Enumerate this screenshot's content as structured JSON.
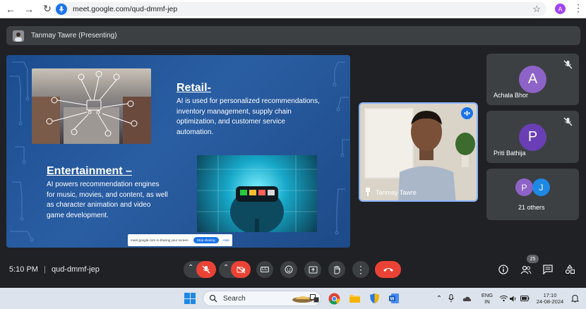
{
  "browser": {
    "url": "meet.google.com/qud-dmmf-jep",
    "profile_initial": "A"
  },
  "meet": {
    "presenting_label": "Tanmay Tawre (Presenting)",
    "meeting_time": "5:10 PM",
    "meeting_code": "qud-dmmf-jep",
    "participant_count": "25"
  },
  "slide": {
    "retail_heading": "Retail-",
    "retail_body": [
      "AI is used for personalized recommendations,",
      "inventory management, supply chain",
      "optimization, and customer service",
      "automation."
    ],
    "entertainment_heading": "Entertainment –",
    "entertainment_body": [
      "AI powers recommendation engines",
      "for music, movies, and content, as well",
      "as character animation and video",
      "game development."
    ],
    "share_notice": "meet.google.com is sharing your screen.",
    "stop_sharing_label": "Stop sharing",
    "hide_label": "Hide"
  },
  "participants": {
    "main_tile_name": "Tanmay Tawre",
    "tiles": [
      {
        "name": "Achala Bhor",
        "initial": "A",
        "color": "#8e63c7"
      },
      {
        "name": "Priti Bathija",
        "initial": "P",
        "color": "#6a3fb5"
      }
    ],
    "others": {
      "label": "21 others",
      "avatars": [
        {
          "initial": "P",
          "color": "#8e63c7"
        },
        {
          "initial": "J",
          "color": "#1e88e5"
        }
      ]
    }
  },
  "controls": {
    "accent_red": "#ea4335",
    "button_gray": "#3c4043",
    "cc_label": "CC"
  },
  "taskbar": {
    "search_label": "Search",
    "lang_line1": "ENG",
    "lang_line2": "IN",
    "clock_time": "17:10",
    "clock_date": "24-08-2024"
  }
}
